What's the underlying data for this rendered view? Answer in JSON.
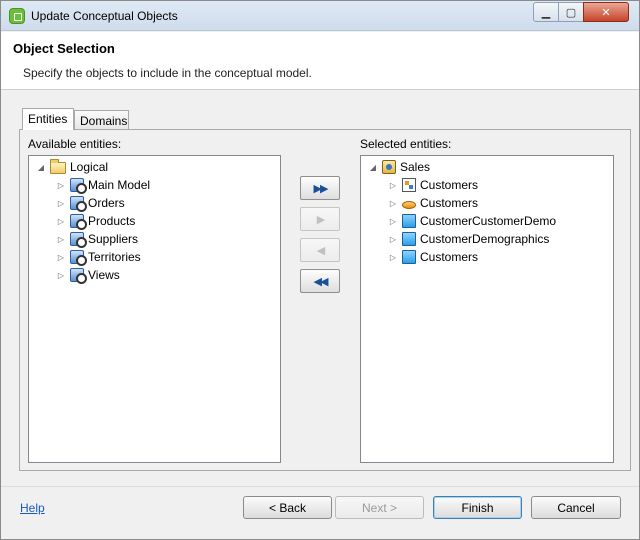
{
  "window": {
    "title": "Update Conceptual Objects"
  },
  "header": {
    "title": "Object Selection",
    "description": "Specify the objects to include in the conceptual model."
  },
  "tabs": [
    {
      "label": "Entities",
      "selected": true
    },
    {
      "label": "Domains",
      "selected": false
    }
  ],
  "available": {
    "label": "Available entities:",
    "root": {
      "label": "Logical",
      "icon": "folder-open-icon"
    },
    "children": [
      {
        "label": "Main Model",
        "icon": "model-icon"
      },
      {
        "label": "Orders",
        "icon": "model-icon"
      },
      {
        "label": "Products",
        "icon": "model-icon"
      },
      {
        "label": "Suppliers",
        "icon": "model-icon"
      },
      {
        "label": "Territories",
        "icon": "model-icon"
      },
      {
        "label": "Views",
        "icon": "model-icon"
      }
    ]
  },
  "selected": {
    "label": "Selected entities:",
    "root": {
      "label": "Sales",
      "icon": "sales-model-icon"
    },
    "children": [
      {
        "label": "Customers",
        "icon": "diagram-icon"
      },
      {
        "label": "Customers",
        "icon": "ellipse-icon"
      },
      {
        "label": "CustomerCustomerDemo",
        "icon": "entity-icon"
      },
      {
        "label": "CustomerDemographics",
        "icon": "entity-icon"
      },
      {
        "label": "Customers",
        "icon": "entity-icon"
      }
    ]
  },
  "transfer": {
    "add_all": "▶▶",
    "add": "▶",
    "remove": "◀",
    "remove_all": "◀◀"
  },
  "footer": {
    "help": "Help",
    "back": "< Back",
    "next": "Next >",
    "finish": "Finish",
    "cancel": "Cancel"
  }
}
